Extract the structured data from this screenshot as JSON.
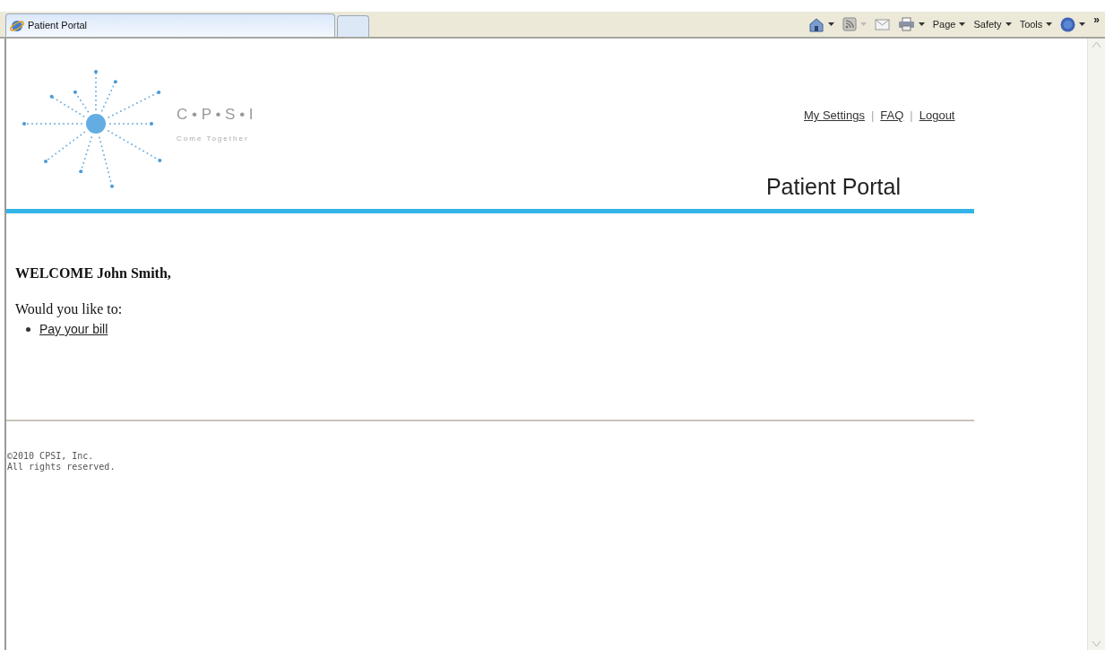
{
  "browser": {
    "tabs": [
      {
        "label": "Patient Portal",
        "selected": true
      }
    ],
    "menus": [
      "Page",
      "Safety",
      "Tools"
    ],
    "overflow": "»"
  },
  "header": {
    "logo": {
      "letters": "C • P • S • I",
      "tagline": "Come Together"
    },
    "links": [
      {
        "kind": "link",
        "text": "My Settings"
      },
      {
        "kind": "separator",
        "text": "|"
      },
      {
        "kind": "link",
        "text": "FAQ"
      },
      {
        "kind": "separator",
        "text": "|"
      },
      {
        "kind": "link",
        "text": "Logout"
      }
    ],
    "title": "Patient Portal"
  },
  "content": {
    "welcome": "WELCOME John Smith,",
    "prompt": "Would you like to:",
    "actions": [
      "Pay your bill"
    ]
  },
  "footer": {
    "lines": [
      "©2010 CPSI, Inc.",
      "All rights reserved."
    ]
  }
}
